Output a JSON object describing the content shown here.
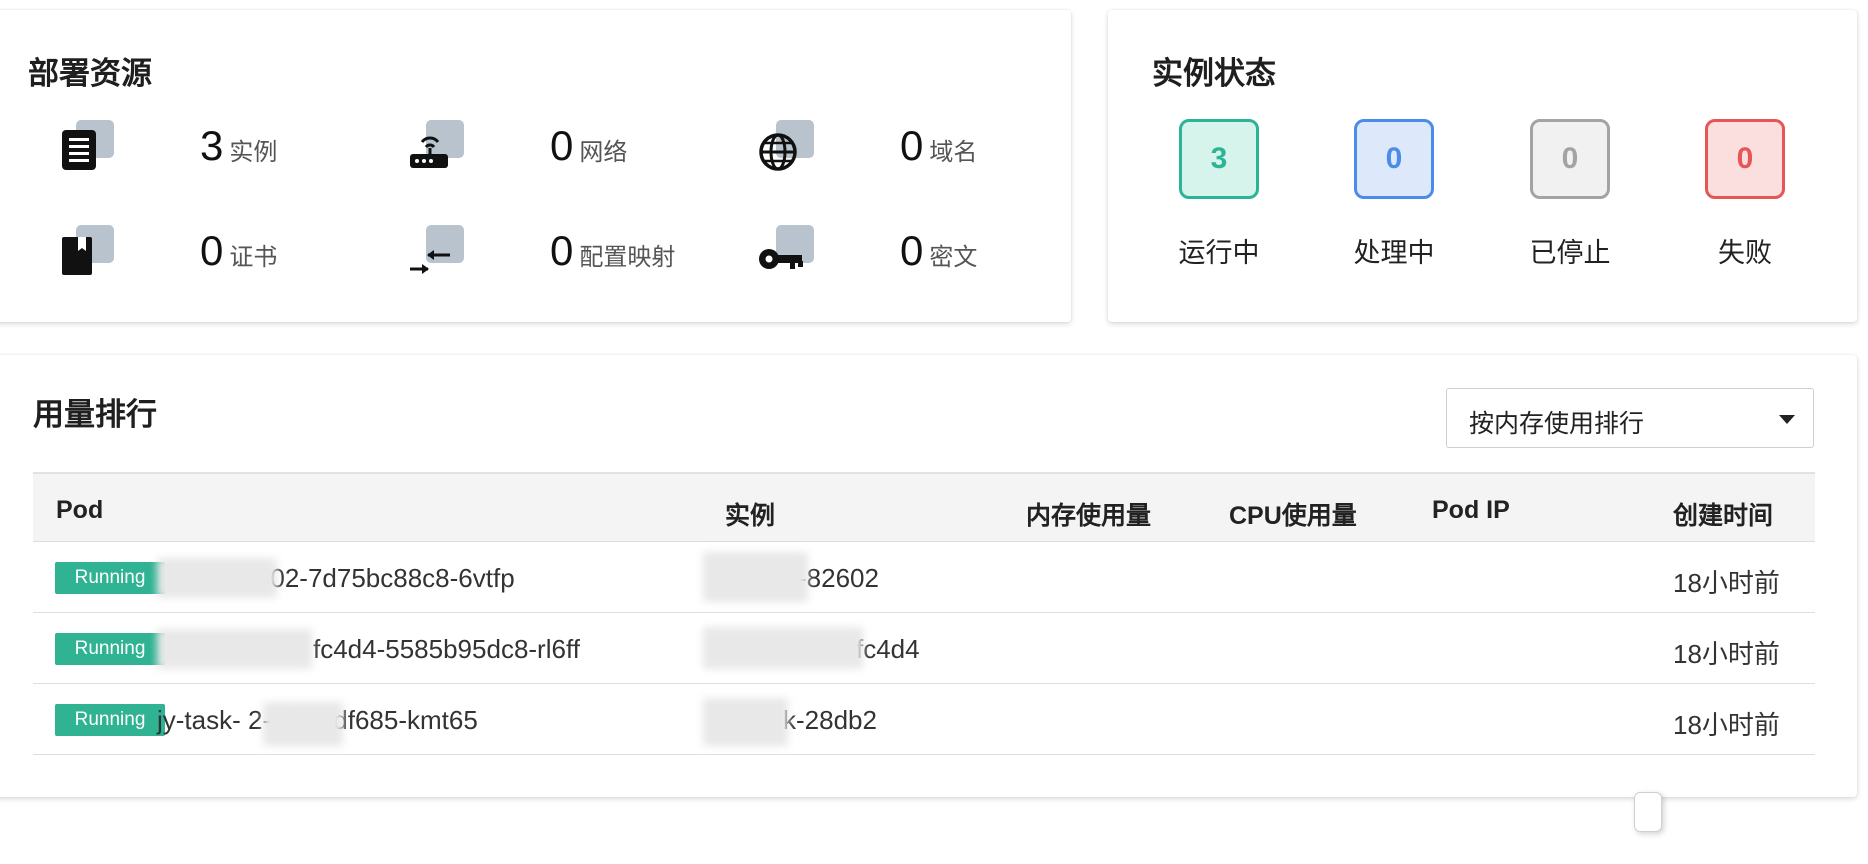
{
  "resources": {
    "title": "部署资源",
    "items": [
      {
        "value": "3",
        "label": "实例",
        "icon": "instance-icon"
      },
      {
        "value": "0",
        "label": "网络",
        "icon": "router-icon"
      },
      {
        "value": "0",
        "label": "域名",
        "icon": "globe-icon"
      },
      {
        "value": "0",
        "label": "证书",
        "icon": "certificate-icon"
      },
      {
        "value": "0",
        "label": "配置映射",
        "icon": "config-map-icon"
      },
      {
        "value": "0",
        "label": "密文",
        "icon": "key-icon"
      }
    ]
  },
  "status": {
    "title": "实例状态",
    "items": [
      {
        "value": "3",
        "label": "运行中",
        "color": "#2bb596",
        "bg": "#d6f3ec"
      },
      {
        "value": "0",
        "label": "处理中",
        "color": "#4a8ce8",
        "bg": "#dde9fb"
      },
      {
        "value": "0",
        "label": "已停止",
        "color": "#a3a3a3",
        "bg": "#f1f1f1"
      },
      {
        "value": "0",
        "label": "失败",
        "color": "#e55656",
        "bg": "#fbdfdf"
      }
    ]
  },
  "usage": {
    "title": "用量排行",
    "sort_select": {
      "value": "按内存使用排行"
    },
    "columns": [
      "Pod",
      "实例",
      "内存使用量",
      "CPU使用量",
      "Pod IP",
      "创建时间"
    ],
    "rows": [
      {
        "status": "Running",
        "pod": "82602-7d75bc88c8-6vtfp",
        "instance": "-82602",
        "memory": "",
        "cpu": "",
        "ip": "",
        "created": "18小时前"
      },
      {
        "status": "Running",
        "pod": "fc4d4-5585b95dc8-rl6ff",
        "instance": "fc4d4",
        "memory": "",
        "cpu": "",
        "ip": "",
        "created": "18小时前"
      },
      {
        "status": "Running",
        "pod": "jy-task-      2-7fc5cdf685-kmt65",
        "instance": "k-28db2",
        "memory": "",
        "cpu": "",
        "ip": "",
        "created": "18小时前"
      }
    ]
  }
}
